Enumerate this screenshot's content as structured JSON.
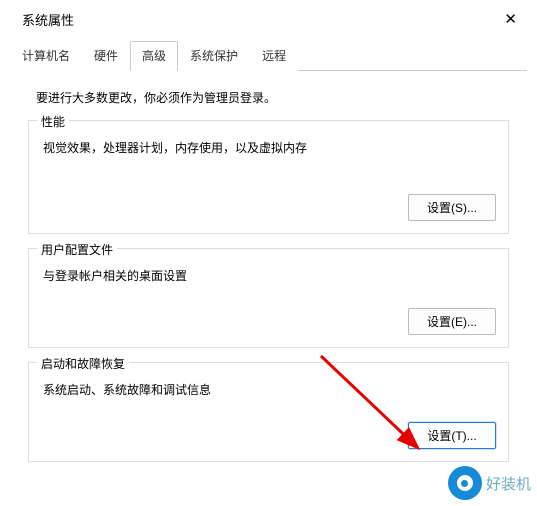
{
  "window": {
    "title": "系统属性",
    "close": "✕"
  },
  "tabs": {
    "items": [
      {
        "label": "计算机名"
      },
      {
        "label": "硬件"
      },
      {
        "label": "高级"
      },
      {
        "label": "系统保护"
      },
      {
        "label": "远程"
      }
    ],
    "active_index": 2
  },
  "note": "要进行大多数更改，你必须作为管理员登录。",
  "groups": {
    "performance": {
      "title": "性能",
      "desc": "视觉效果，处理器计划，内存使用，以及虚拟内存",
      "button": "设置(S)..."
    },
    "user_profiles": {
      "title": "用户配置文件",
      "desc": "与登录帐户相关的桌面设置",
      "button": "设置(E)..."
    },
    "startup": {
      "title": "启动和故障恢复",
      "desc": "系统启动、系统故障和调试信息",
      "button": "设置(T)..."
    }
  },
  "watermark": {
    "text": "好装机"
  }
}
